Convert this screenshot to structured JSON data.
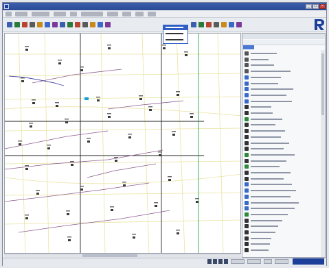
{
  "app": {
    "accent_color": "#2a4a94",
    "window_buttons": [
      "minimize",
      "maximize",
      "close"
    ]
  },
  "toolbar": {
    "icons": [
      "open-icon",
      "save-icon",
      "print-icon",
      "cut-icon",
      "copy-icon",
      "paste-icon",
      "add-object-icon",
      "delete-icon",
      "grid-icon",
      "schedule-icon",
      "layout-icon",
      "chart-icon",
      "report-icon",
      "help-icon",
      "cursor-icon",
      "zoom-in-icon",
      "zoom-out-icon",
      "select-icon",
      "undo-icon",
      "redo-icon",
      "filter-icon"
    ],
    "dropdown_options": 3
  },
  "canvas": {
    "line_colors": {
      "bus": "#222222",
      "feeder": "#8b5a8e",
      "branch": "#4a4aa8",
      "ground": "#e9e3a2",
      "highlight": "#2aa04a",
      "accent": "#1a9fd8"
    }
  },
  "side_panel": {
    "tree_items": [
      {
        "icon": "arrow-icon",
        "color": "#555"
      },
      {
        "icon": "arrow-icon",
        "color": "#555"
      },
      {
        "icon": "arrow-icon",
        "color": "#555"
      },
      {
        "icon": "arrow-icon",
        "color": "#555"
      },
      {
        "icon": "pen-icon",
        "color": "#3a6ac8"
      },
      {
        "icon": "pen-icon",
        "color": "#3a6ac8"
      },
      {
        "icon": "pen-icon",
        "color": "#3a6ac8"
      },
      {
        "icon": "pen-icon",
        "color": "#3a6ac8"
      },
      {
        "icon": "pen-icon",
        "color": "#3a6ac8"
      },
      {
        "icon": "block-icon",
        "color": "#333"
      },
      {
        "icon": "block-icon",
        "color": "#333"
      },
      {
        "icon": "grid-icon",
        "color": "#2e8a3a"
      },
      {
        "icon": "block-icon",
        "color": "#333"
      },
      {
        "icon": "block-icon",
        "color": "#333"
      },
      {
        "icon": "block-icon",
        "color": "#333"
      },
      {
        "icon": "block-icon",
        "color": "#333"
      },
      {
        "icon": "block-icon",
        "color": "#333"
      },
      {
        "icon": "grid-icon",
        "color": "#2e8a3a"
      },
      {
        "icon": "block-icon",
        "color": "#333"
      },
      {
        "icon": "grid-icon",
        "color": "#2e8a3a"
      },
      {
        "icon": "block-icon",
        "color": "#333"
      },
      {
        "icon": "block-icon",
        "color": "#333"
      },
      {
        "icon": "wave-icon",
        "color": "#3a6ac8"
      },
      {
        "icon": "wave-icon",
        "color": "#3a6ac8"
      },
      {
        "icon": "wave-icon",
        "color": "#3a6ac8"
      },
      {
        "icon": "wave-icon",
        "color": "#3a6ac8"
      },
      {
        "icon": "wave-icon",
        "color": "#3a6ac8"
      },
      {
        "icon": "grid-icon",
        "color": "#2e8a3a"
      },
      {
        "icon": "block-icon",
        "color": "#333"
      },
      {
        "icon": "block-icon",
        "color": "#333"
      },
      {
        "icon": "block-icon",
        "color": "#333"
      },
      {
        "icon": "block-icon",
        "color": "#333"
      },
      {
        "icon": "block-icon",
        "color": "#333"
      },
      {
        "icon": "block-icon",
        "color": "#333"
      }
    ]
  },
  "status_bar": {
    "brand_color": "#1c3f9a"
  }
}
